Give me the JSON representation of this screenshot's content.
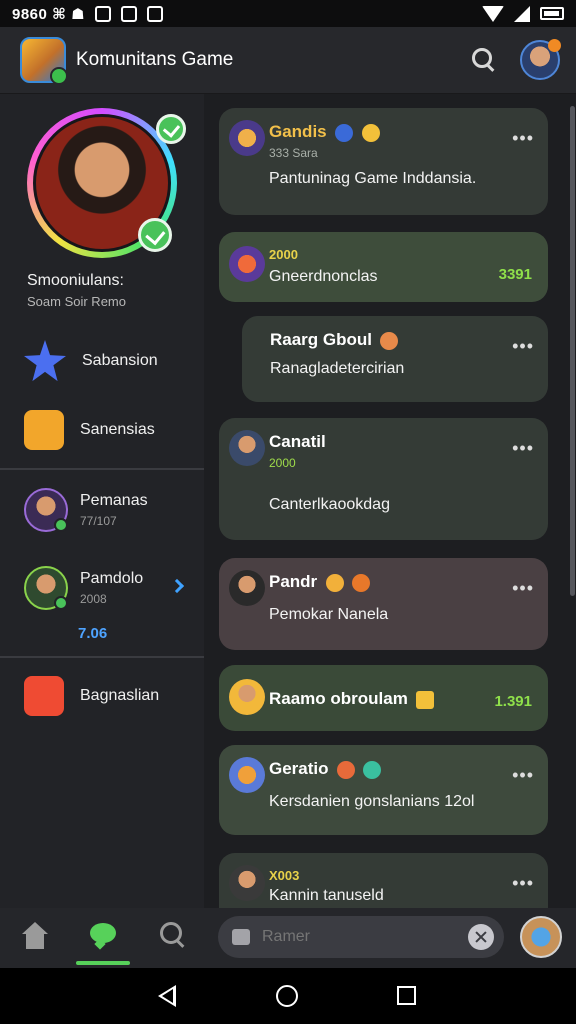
{
  "status": {
    "time": "9860 ⌘ ☗"
  },
  "app": {
    "title": "Komunitans Game"
  },
  "sidebar": {
    "profile": {
      "name": "Smooniulans:",
      "sub": "Soam Soir Remo"
    },
    "items": [
      {
        "label": "Sabansion"
      },
      {
        "label": "Sanensias"
      },
      {
        "label": "Pemanas",
        "sub": "77/107"
      },
      {
        "label": "Pamdolo",
        "sub": "2008",
        "extra": "7.06"
      },
      {
        "label": "Bagnaslian"
      }
    ]
  },
  "feed": {
    "cards": [
      {
        "name": "Gandis",
        "meta": "333 Sara",
        "msg": "Pantuninag Game Inddansia.",
        "dots": "•••"
      },
      {
        "name": "2000",
        "meta": "",
        "msg": "Gneerdnonclas",
        "num": "3391"
      },
      {
        "name": "Raarg Gboul",
        "meta": "",
        "msg": "Ranagladetercirian",
        "dots": "•••"
      },
      {
        "name": "Canatil",
        "meta": "2000",
        "msg": "Canterlkaookdag",
        "dots": "•••"
      },
      {
        "name": "Pandr",
        "meta": "",
        "msg": "Pemokar Nanela",
        "dots": "•••"
      },
      {
        "name": "Raamo obroulam",
        "meta": "",
        "msg": "",
        "num": "1.391"
      },
      {
        "name": "Geratio",
        "meta": "",
        "msg": "Kersdanien gonslanians 12ol",
        "dots": "•••"
      },
      {
        "name": "X003",
        "meta": "",
        "msg": "Kannin tanuseld",
        "dots": "•••"
      }
    ]
  },
  "composer": {
    "placeholder": "Ramer"
  },
  "colors": {
    "card_green": "#3c4a3a",
    "card_dark": "#353b37",
    "card_rose": "#4a4043",
    "accent": "#57d15a"
  }
}
